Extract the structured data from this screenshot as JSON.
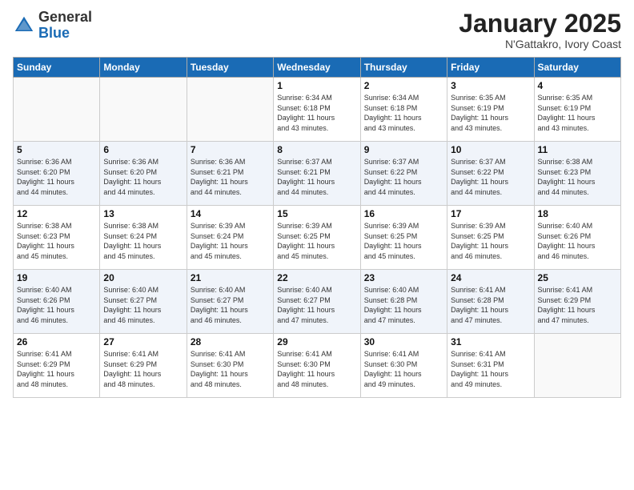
{
  "header": {
    "logo_general": "General",
    "logo_blue": "Blue",
    "month_title": "January 2025",
    "location": "N'Gattakro, Ivory Coast"
  },
  "weekdays": [
    "Sunday",
    "Monday",
    "Tuesday",
    "Wednesday",
    "Thursday",
    "Friday",
    "Saturday"
  ],
  "weeks": [
    [
      {
        "day": "",
        "info": ""
      },
      {
        "day": "",
        "info": ""
      },
      {
        "day": "",
        "info": ""
      },
      {
        "day": "1",
        "info": "Sunrise: 6:34 AM\nSunset: 6:18 PM\nDaylight: 11 hours\nand 43 minutes."
      },
      {
        "day": "2",
        "info": "Sunrise: 6:34 AM\nSunset: 6:18 PM\nDaylight: 11 hours\nand 43 minutes."
      },
      {
        "day": "3",
        "info": "Sunrise: 6:35 AM\nSunset: 6:19 PM\nDaylight: 11 hours\nand 43 minutes."
      },
      {
        "day": "4",
        "info": "Sunrise: 6:35 AM\nSunset: 6:19 PM\nDaylight: 11 hours\nand 43 minutes."
      }
    ],
    [
      {
        "day": "5",
        "info": "Sunrise: 6:36 AM\nSunset: 6:20 PM\nDaylight: 11 hours\nand 44 minutes."
      },
      {
        "day": "6",
        "info": "Sunrise: 6:36 AM\nSunset: 6:20 PM\nDaylight: 11 hours\nand 44 minutes."
      },
      {
        "day": "7",
        "info": "Sunrise: 6:36 AM\nSunset: 6:21 PM\nDaylight: 11 hours\nand 44 minutes."
      },
      {
        "day": "8",
        "info": "Sunrise: 6:37 AM\nSunset: 6:21 PM\nDaylight: 11 hours\nand 44 minutes."
      },
      {
        "day": "9",
        "info": "Sunrise: 6:37 AM\nSunset: 6:22 PM\nDaylight: 11 hours\nand 44 minutes."
      },
      {
        "day": "10",
        "info": "Sunrise: 6:37 AM\nSunset: 6:22 PM\nDaylight: 11 hours\nand 44 minutes."
      },
      {
        "day": "11",
        "info": "Sunrise: 6:38 AM\nSunset: 6:23 PM\nDaylight: 11 hours\nand 44 minutes."
      }
    ],
    [
      {
        "day": "12",
        "info": "Sunrise: 6:38 AM\nSunset: 6:23 PM\nDaylight: 11 hours\nand 45 minutes."
      },
      {
        "day": "13",
        "info": "Sunrise: 6:38 AM\nSunset: 6:24 PM\nDaylight: 11 hours\nand 45 minutes."
      },
      {
        "day": "14",
        "info": "Sunrise: 6:39 AM\nSunset: 6:24 PM\nDaylight: 11 hours\nand 45 minutes."
      },
      {
        "day": "15",
        "info": "Sunrise: 6:39 AM\nSunset: 6:25 PM\nDaylight: 11 hours\nand 45 minutes."
      },
      {
        "day": "16",
        "info": "Sunrise: 6:39 AM\nSunset: 6:25 PM\nDaylight: 11 hours\nand 45 minutes."
      },
      {
        "day": "17",
        "info": "Sunrise: 6:39 AM\nSunset: 6:25 PM\nDaylight: 11 hours\nand 46 minutes."
      },
      {
        "day": "18",
        "info": "Sunrise: 6:40 AM\nSunset: 6:26 PM\nDaylight: 11 hours\nand 46 minutes."
      }
    ],
    [
      {
        "day": "19",
        "info": "Sunrise: 6:40 AM\nSunset: 6:26 PM\nDaylight: 11 hours\nand 46 minutes."
      },
      {
        "day": "20",
        "info": "Sunrise: 6:40 AM\nSunset: 6:27 PM\nDaylight: 11 hours\nand 46 minutes."
      },
      {
        "day": "21",
        "info": "Sunrise: 6:40 AM\nSunset: 6:27 PM\nDaylight: 11 hours\nand 46 minutes."
      },
      {
        "day": "22",
        "info": "Sunrise: 6:40 AM\nSunset: 6:27 PM\nDaylight: 11 hours\nand 47 minutes."
      },
      {
        "day": "23",
        "info": "Sunrise: 6:40 AM\nSunset: 6:28 PM\nDaylight: 11 hours\nand 47 minutes."
      },
      {
        "day": "24",
        "info": "Sunrise: 6:41 AM\nSunset: 6:28 PM\nDaylight: 11 hours\nand 47 minutes."
      },
      {
        "day": "25",
        "info": "Sunrise: 6:41 AM\nSunset: 6:29 PM\nDaylight: 11 hours\nand 47 minutes."
      }
    ],
    [
      {
        "day": "26",
        "info": "Sunrise: 6:41 AM\nSunset: 6:29 PM\nDaylight: 11 hours\nand 48 minutes."
      },
      {
        "day": "27",
        "info": "Sunrise: 6:41 AM\nSunset: 6:29 PM\nDaylight: 11 hours\nand 48 minutes."
      },
      {
        "day": "28",
        "info": "Sunrise: 6:41 AM\nSunset: 6:30 PM\nDaylight: 11 hours\nand 48 minutes."
      },
      {
        "day": "29",
        "info": "Sunrise: 6:41 AM\nSunset: 6:30 PM\nDaylight: 11 hours\nand 48 minutes."
      },
      {
        "day": "30",
        "info": "Sunrise: 6:41 AM\nSunset: 6:30 PM\nDaylight: 11 hours\nand 49 minutes."
      },
      {
        "day": "31",
        "info": "Sunrise: 6:41 AM\nSunset: 6:31 PM\nDaylight: 11 hours\nand 49 minutes."
      },
      {
        "day": "",
        "info": ""
      }
    ]
  ]
}
